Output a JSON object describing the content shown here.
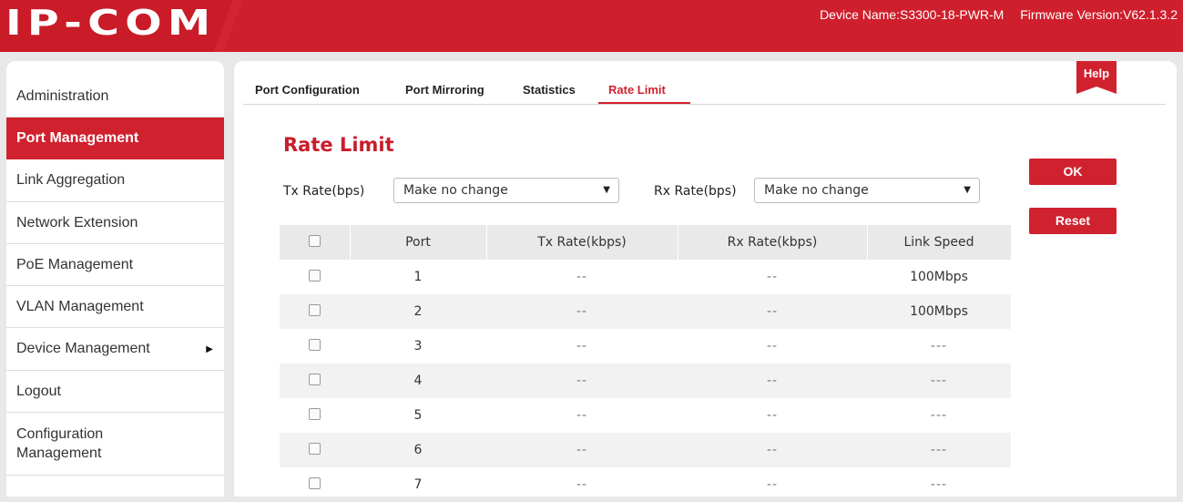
{
  "header": {
    "logo": "IP-COM",
    "device_name": "Device Name:S3300-18-PWR-M",
    "firmware": "Firmware Version:V62.1.3.2"
  },
  "sidebar": {
    "items": [
      {
        "label": "Administration"
      },
      {
        "label": "Port Management"
      },
      {
        "label": "Link Aggregation"
      },
      {
        "label": "Network Extension"
      },
      {
        "label": "PoE Management"
      },
      {
        "label": "VLAN Management"
      },
      {
        "label": "Device Management"
      },
      {
        "label": "Logout"
      },
      {
        "label": "Configuration Management"
      }
    ],
    "active": "Port Management"
  },
  "tabs": [
    "Port Configuration",
    "Port Mirroring",
    "Statistics",
    "Rate Limit"
  ],
  "active_tab": "Rate Limit",
  "help_label": "Help",
  "page_title": "Rate Limit",
  "controls": {
    "tx_label": "Tx Rate(bps)",
    "tx_value": "Make no change",
    "rx_label": "Rx Rate(bps)",
    "rx_value": "Make no change"
  },
  "buttons": {
    "ok": "OK",
    "reset": "Reset"
  },
  "table": {
    "headers": [
      "Port",
      "Tx Rate(kbps)",
      "Rx Rate(kbps)",
      "Link Speed"
    ],
    "rows": [
      {
        "port": "1",
        "tx": "--",
        "rx": "--",
        "speed": "100Mbps"
      },
      {
        "port": "2",
        "tx": "--",
        "rx": "--",
        "speed": "100Mbps"
      },
      {
        "port": "3",
        "tx": "--",
        "rx": "--",
        "speed": "---"
      },
      {
        "port": "4",
        "tx": "--",
        "rx": "--",
        "speed": "---"
      },
      {
        "port": "5",
        "tx": "--",
        "rx": "--",
        "speed": "---"
      },
      {
        "port": "6",
        "tx": "--",
        "rx": "--",
        "speed": "---"
      },
      {
        "port": "7",
        "tx": "--",
        "rx": "--",
        "speed": "---"
      }
    ]
  },
  "colors": {
    "brand": "#d0212f",
    "header": "#d71f2e"
  }
}
